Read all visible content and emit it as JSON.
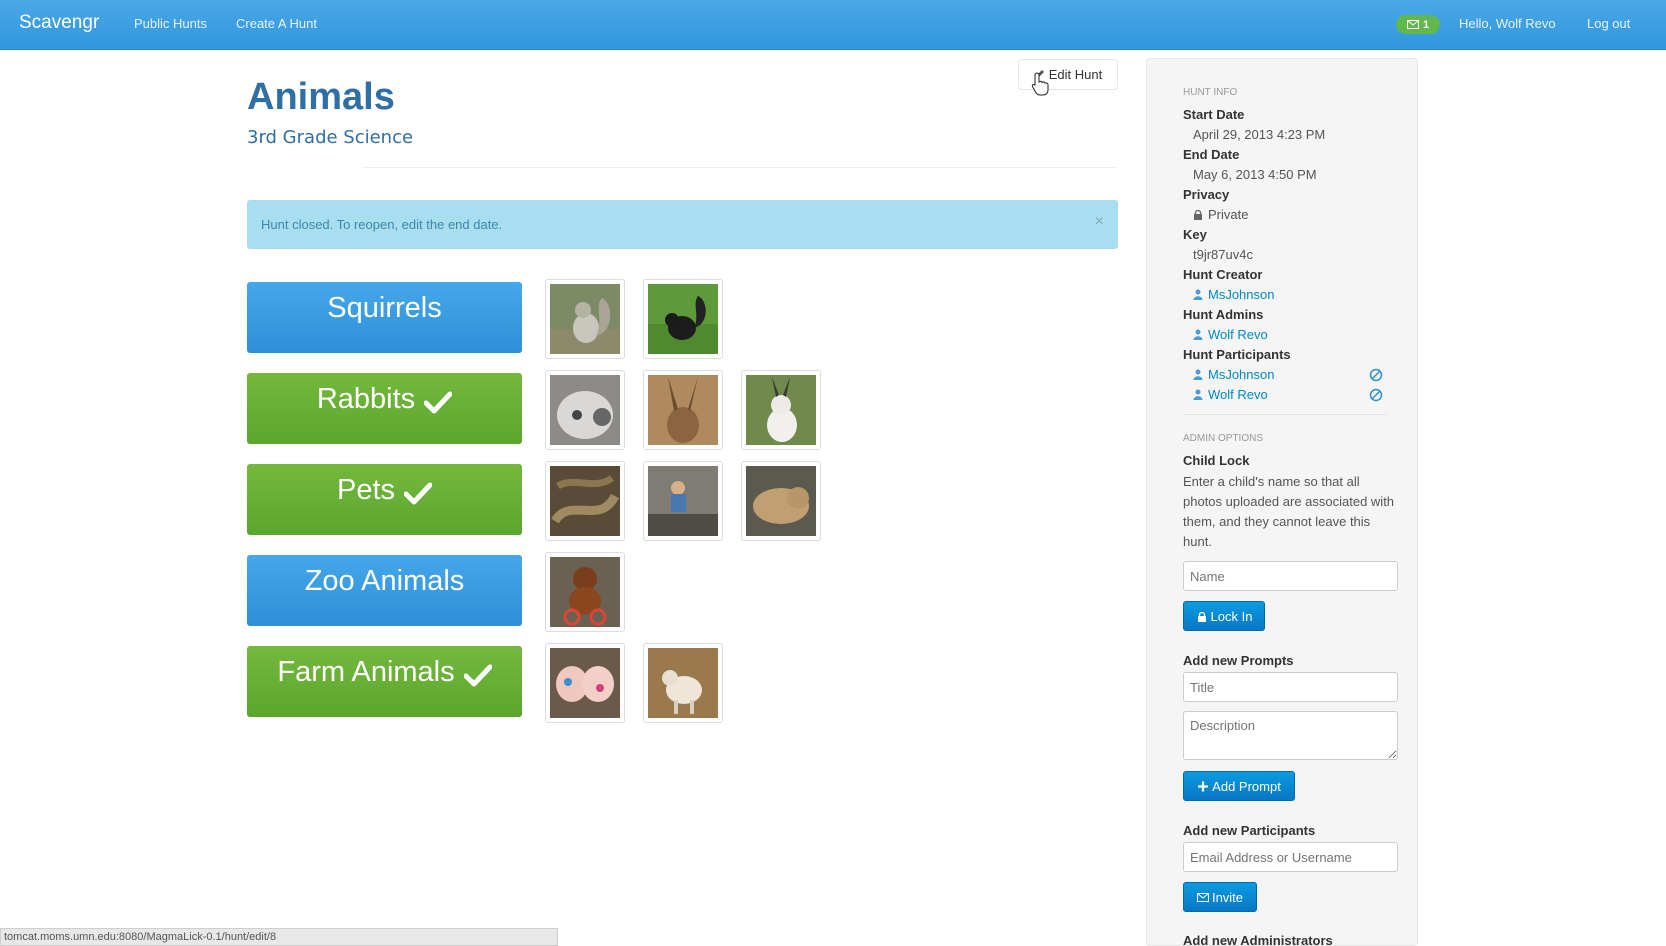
{
  "navbar": {
    "brand": "Scavengr",
    "links": [
      "Public Hunts",
      "Create A Hunt"
    ],
    "message_count": "1",
    "greeting": "Hello, Wolf Revo",
    "logout": "Log out"
  },
  "hunt": {
    "title": "Animals",
    "subtitle": "3rd Grade Science",
    "edit_label": "Edit Hunt",
    "alert_text": "Hunt closed. To reopen, edit the end date.",
    "alert_close": "×"
  },
  "prompts": [
    {
      "label": "Squirrels",
      "completed": false,
      "photos": 2
    },
    {
      "label": "Rabbits",
      "completed": true,
      "photos": 3
    },
    {
      "label": "Pets",
      "completed": true,
      "photos": 3
    },
    {
      "label": "Zoo Animals",
      "completed": false,
      "photos": 1
    },
    {
      "label": "Farm Animals",
      "completed": true,
      "photos": 2
    }
  ],
  "sidebar": {
    "hunt_info_header": "HUNT INFO",
    "start_date_label": "Start Date",
    "start_date": "April 29, 2013 4:23 PM",
    "end_date_label": "End Date",
    "end_date": "May 6, 2013 4:50 PM",
    "privacy_label": "Privacy",
    "privacy": "Private",
    "key_label": "Key",
    "key": "t9jr87uv4c",
    "creator_label": "Hunt Creator",
    "creator": "MsJohnson",
    "admins_label": "Hunt Admins",
    "admins": [
      "Wolf Revo"
    ],
    "participants_label": "Hunt Participants",
    "participants": [
      "MsJohnson",
      "Wolf Revo"
    ],
    "admin_options_header": "ADMIN OPTIONS",
    "child_lock_label": "Child Lock",
    "child_lock_help": "Enter a child's name so that all photos uploaded are associated with them, and they cannot leave this hunt.",
    "name_placeholder": "Name",
    "lock_in_label": "Lock In",
    "add_prompts_label": "Add new Prompts",
    "title_placeholder": "Title",
    "description_placeholder": "Description",
    "add_prompt_label": "Add Prompt",
    "add_participants_label": "Add new Participants",
    "participant_placeholder": "Email Address or Username",
    "invite_label": "Invite",
    "add_admins_label": "Add new Administrators"
  },
  "status_bar": "tomcat.moms.umn.edu:8080/MagmaLick-0.1/hunt/edit/8",
  "colors": {
    "navbar": "#3b9fe2",
    "prompt_blue": "#3a9ce0",
    "prompt_green": "#66ad35",
    "alert_bg": "#a9def0",
    "link": "#0088cc"
  }
}
